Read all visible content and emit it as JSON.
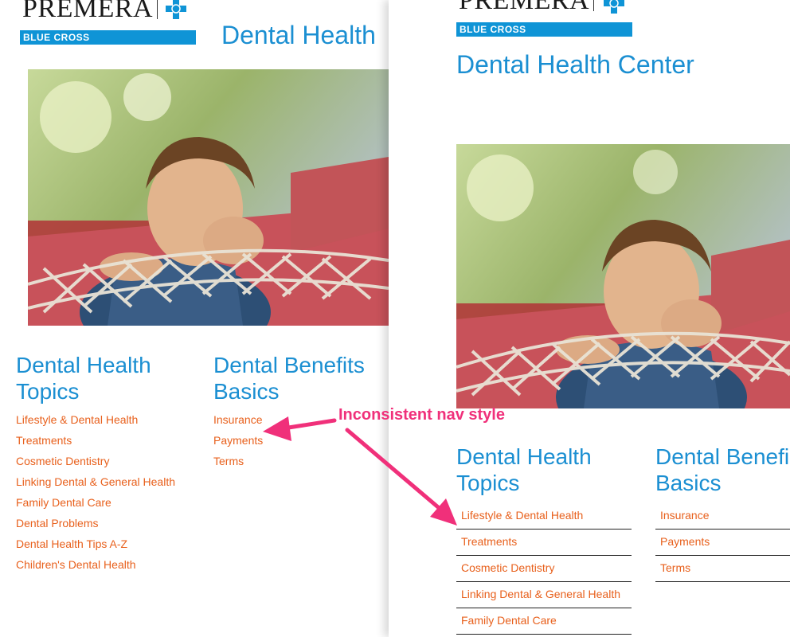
{
  "colors": {
    "title_blue": "#1b8fd2",
    "link_orange": "#e8601c",
    "brand_blue": "#0f94d6",
    "annotation_pink": "#f0307a"
  },
  "left_page": {
    "logo": {
      "wordmark": "PREMERA",
      "bar_label": "BLUE CROSS"
    },
    "title": "Dental Health",
    "topics": {
      "heading_line1": "Dental Health",
      "heading_line2": "Topics",
      "links": [
        "Lifestyle & Dental Health",
        "Treatments",
        "Cosmetic Dentistry",
        "Linking Dental & General Health",
        "Family Dental Care",
        "Dental Problems",
        "Dental Health Tips A-Z",
        "Children's Dental Health"
      ]
    },
    "benefits": {
      "heading_line1": "Dental Benefits",
      "heading_line2": "Basics",
      "links": [
        "Insurance",
        "Payments",
        "Terms"
      ]
    }
  },
  "right_page": {
    "logo": {
      "wordmark": "PREMERA",
      "bar_label": "BLUE CROSS"
    },
    "title": "Dental Health Center",
    "topics": {
      "heading_line1": "Dental Health",
      "heading_line2": "Topics",
      "links": [
        "Lifestyle & Dental Health",
        "Treatments",
        "Cosmetic Dentistry",
        "Linking Dental & General Health",
        "Family Dental Care"
      ]
    },
    "benefits": {
      "heading_line1": "Dental Benefi",
      "heading_line2": "Basics",
      "links": [
        "Insurance",
        "Payments",
        "Terms"
      ]
    }
  },
  "annotation": {
    "text": "Inconsistent nav style"
  }
}
